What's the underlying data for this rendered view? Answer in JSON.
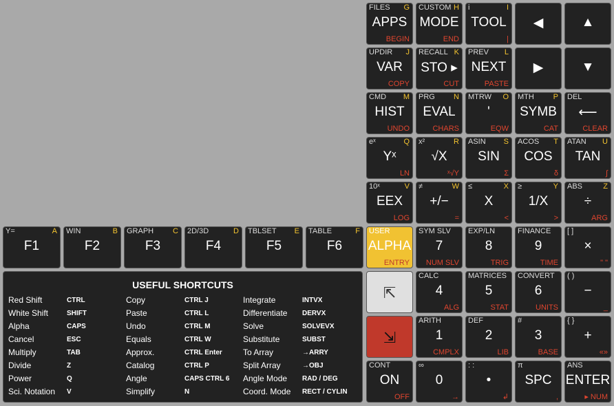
{
  "colors": {
    "background": "#a9a9a9",
    "key": "#222222",
    "alpha_key": "#f1c232",
    "left_shift_key": "#e0e0e0",
    "right_shift_key": "#c0392b",
    "alpha_label": "#f4c430",
    "right_shift_label": "#e0452f"
  },
  "keys": [
    {
      "ml": "FILES",
      "mr": "G",
      "main": "APPS",
      "sub": "BEGIN"
    },
    {
      "ml": "CUSTOM",
      "mr": "H",
      "main": "MODE",
      "sub": "END"
    },
    {
      "ml": "i",
      "mr": "I",
      "main": "TOOL",
      "sub": "|"
    },
    {
      "ml": "",
      "mr": "",
      "main": "◀",
      "sub": ""
    },
    {
      "ml": "",
      "mr": "",
      "main": "▲",
      "sub": ""
    },
    {
      "ml": "UPDIR",
      "mr": "J",
      "main": "VAR",
      "sub": "COPY"
    },
    {
      "ml": "RECALL",
      "mr": "K",
      "main": "STO ▸",
      "sub": "CUT"
    },
    {
      "ml": "PREV",
      "mr": "L",
      "main": "NEXT",
      "sub": "PASTE"
    },
    {
      "ml": "",
      "mr": "",
      "main": "▶",
      "sub": ""
    },
    {
      "ml": "",
      "mr": "",
      "main": "▼",
      "sub": ""
    },
    {
      "ml": "CMD",
      "mr": "M",
      "main": "HIST",
      "sub": "UNDO"
    },
    {
      "ml": "PRG",
      "mr": "N",
      "main": "EVAL",
      "sub": "CHARS"
    },
    {
      "ml": "MTRW",
      "mr": "O",
      "main": "'",
      "sub": "EQW"
    },
    {
      "ml": "MTH",
      "mr": "P",
      "main": "SYMB",
      "sub": "CAT"
    },
    {
      "ml": "DEL",
      "mr": "",
      "main": "⟵",
      "sub": "CLEAR"
    },
    {
      "ml": "eˣ",
      "mr": "Q",
      "main": "Yˣ",
      "sub": "LN"
    },
    {
      "ml": "x²",
      "mr": "R",
      "main": "√X",
      "sub": "ˣ√Y"
    },
    {
      "ml": "ASIN",
      "mr": "S",
      "main": "SIN",
      "sub": "Σ"
    },
    {
      "ml": "ACOS",
      "mr": "T",
      "main": "COS",
      "sub": "δ"
    },
    {
      "ml": "ATAN",
      "mr": "U",
      "main": "TAN",
      "sub": "∫"
    },
    {
      "ml": "10ˣ",
      "mr": "V",
      "main": "EEX",
      "sub": "LOG"
    },
    {
      "ml": "≠",
      "mr": "W",
      "main": "+/−",
      "sub": "="
    },
    {
      "ml": "≤",
      "mr": "X",
      "main": "X",
      "sub": "<"
    },
    {
      "ml": "≥",
      "mr": "Y",
      "main": "1/X",
      "sub": ">"
    },
    {
      "ml": "ABS",
      "mr": "Z",
      "main": "÷",
      "sub": "ARG"
    },
    {
      "ml": "Y=",
      "mr": "A",
      "main": "F1",
      "sub": ""
    },
    {
      "ml": "WIN",
      "mr": "B",
      "main": "F2",
      "sub": ""
    },
    {
      "ml": "GRAPH",
      "mr": "C",
      "main": "F3",
      "sub": ""
    },
    {
      "ml": "2D/3D",
      "mr": "D",
      "main": "F4",
      "sub": ""
    },
    {
      "ml": "TBLSET",
      "mr": "E",
      "main": "F5",
      "sub": ""
    },
    {
      "ml": "TABLE",
      "mr": "F",
      "main": "F6",
      "sub": ""
    },
    {
      "ml": "USER",
      "mr": "",
      "main": "ALPHA",
      "sub": "ENTRY"
    },
    {
      "ml": "SYM SLV",
      "mr": "",
      "main": "7",
      "sub": "NUM SLV"
    },
    {
      "ml": "EXP/LN",
      "mr": "",
      "main": "8",
      "sub": "TRIG"
    },
    {
      "ml": "FINANCE",
      "mr": "",
      "main": "9",
      "sub": "TIME"
    },
    {
      "ml": "[ ]",
      "mr": "",
      "main": "×",
      "sub": "\" \""
    },
    {
      "ml": "",
      "mr": "",
      "main": "⇱",
      "sub": ""
    },
    {
      "ml": "CALC",
      "mr": "",
      "main": "4",
      "sub": "ALG"
    },
    {
      "ml": "MATRICES",
      "mr": "",
      "main": "5",
      "sub": "STAT"
    },
    {
      "ml": "CONVERT",
      "mr": "",
      "main": "6",
      "sub": "UNITS"
    },
    {
      "ml": "( )",
      "mr": "",
      "main": "−",
      "sub": "_"
    },
    {
      "ml": "",
      "mr": "",
      "main": "⇲",
      "sub": ""
    },
    {
      "ml": "ARITH",
      "mr": "",
      "main": "1",
      "sub": "CMPLX"
    },
    {
      "ml": "DEF",
      "mr": "",
      "main": "2",
      "sub": "LIB"
    },
    {
      "ml": "#",
      "mr": "",
      "main": "3",
      "sub": "BASE"
    },
    {
      "ml": "{ }",
      "mr": "",
      "main": "+",
      "sub": "«»"
    },
    {
      "ml": "CONT",
      "mr": "",
      "main": "ON",
      "sub": "OFF"
    },
    {
      "ml": "∞",
      "mr": "",
      "main": "0",
      "sub": "→"
    },
    {
      "ml": ": :",
      "mr": "",
      "main": "•",
      "sub": "↲"
    },
    {
      "ml": "π",
      "mr": "",
      "main": "SPC",
      "sub": ","
    },
    {
      "ml": "ANS",
      "mr": "",
      "main": "ENTER",
      "sub": "▸ NUM"
    }
  ],
  "shortcuts": {
    "title": "USEFUL SHORTCUTS",
    "col1": [
      {
        "name": "Red Shift",
        "key": "CTRL"
      },
      {
        "name": "White Shift",
        "key": "SHIFT"
      },
      {
        "name": "Alpha",
        "key": "CAPS"
      },
      {
        "name": "Cancel",
        "key": "ESC"
      },
      {
        "name": "Multiply",
        "key": "TAB"
      },
      {
        "name": "Divide",
        "key": "Z"
      },
      {
        "name": "Power",
        "key": "Q"
      },
      {
        "name": "Sci. Notation",
        "key": "V"
      }
    ],
    "col2": [
      {
        "name": "Copy",
        "key": "CTRL J"
      },
      {
        "name": "Paste",
        "key": "CTRL L"
      },
      {
        "name": "Undo",
        "key": "CTRL M"
      },
      {
        "name": "Equals",
        "key": "CTRL W"
      },
      {
        "name": "Approx.",
        "key": "CTRL Enter"
      },
      {
        "name": "Catalog",
        "key": "CTRL P"
      },
      {
        "name": "Angle",
        "key": "CAPS CTRL 6"
      },
      {
        "name": "Simplify",
        "key": "N"
      }
    ],
    "col3": [
      {
        "name": "Integrate",
        "key": "INTVX"
      },
      {
        "name": "Differentiate",
        "key": "DERVX"
      },
      {
        "name": "Solve",
        "key": "SOLVEVX"
      },
      {
        "name": "Substitute",
        "key": "SUBST"
      },
      {
        "name": "To Array",
        "key": "→ARRY"
      },
      {
        "name": "Split Array",
        "key": "→OBJ"
      },
      {
        "name": "Angle Mode",
        "key": "RAD / DEG"
      },
      {
        "name": "Coord. Mode",
        "key": "RECT / CYLIN"
      }
    ]
  }
}
